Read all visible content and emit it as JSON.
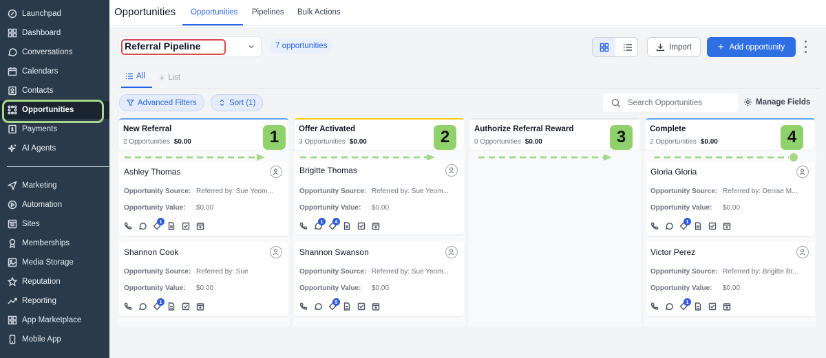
{
  "sidebar": {
    "items": [
      {
        "label": "Launchpad",
        "icon": "rocket-icon"
      },
      {
        "label": "Dashboard",
        "icon": "dashboard-icon"
      },
      {
        "label": "Conversations",
        "icon": "chat-icon"
      },
      {
        "label": "Calendars",
        "icon": "calendar-icon"
      },
      {
        "label": "Contacts",
        "icon": "contacts-icon"
      },
      {
        "label": "Opportunities",
        "icon": "opportunities-icon"
      },
      {
        "label": "Payments",
        "icon": "payments-icon"
      },
      {
        "label": "AI Agents",
        "icon": "sparkle-icon"
      },
      {
        "label": "Marketing",
        "icon": "send-icon"
      },
      {
        "label": "Automation",
        "icon": "automation-icon"
      },
      {
        "label": "Sites",
        "icon": "sites-icon"
      },
      {
        "label": "Memberships",
        "icon": "membership-icon"
      },
      {
        "label": "Media Storage",
        "icon": "image-icon"
      },
      {
        "label": "Reputation",
        "icon": "star-icon"
      },
      {
        "label": "Reporting",
        "icon": "chart-icon"
      },
      {
        "label": "App Marketplace",
        "icon": "apps-icon"
      },
      {
        "label": "Mobile App",
        "icon": "mobile-icon"
      }
    ],
    "active": "Opportunities"
  },
  "header": {
    "title": "Opportunities",
    "tabs": [
      "Opportunities",
      "Pipelines",
      "Bulk Actions"
    ],
    "active_tab": "Opportunities"
  },
  "toolbar": {
    "pipeline": "Referral Pipeline",
    "count": "7 opportunities",
    "import_label": "Import",
    "add_label": "Add opportunity"
  },
  "views": {
    "all": "All",
    "list": "List"
  },
  "filters": {
    "advanced": "Advanced Filters",
    "sort": "Sort (1)",
    "search_placeholder": "Search Opportunities",
    "manage_fields": "Manage Fields"
  },
  "colors": {
    "accent": "#2f6fe4",
    "highlight_green": "#8fd16a",
    "stage_new": "#60a5fa",
    "stage_offer": "#facc15",
    "stage_complete": "#60a5fa"
  },
  "card_labels": {
    "source": "Opportunity Source:",
    "value": "Opportunity Value:"
  },
  "columns": [
    {
      "title": "New Referral",
      "count": "2 Opportunities",
      "amount": "$0.00",
      "badge": "1",
      "cards": [
        {
          "name": "Ashley Thomas",
          "source": "Referred by: Sue Yeom...",
          "value": "$0.00",
          "badge": "1"
        },
        {
          "name": "Shannon Cook",
          "source": "Referred by: Sue",
          "value": "$0.00",
          "badge": "1"
        }
      ]
    },
    {
      "title": "Offer Activated",
      "count": "3 Opportunities",
      "amount": "$0.00",
      "badge": "2",
      "cards": [
        {
          "name": "Brigitte Thomas",
          "source": "Referred by: Sue Yeom...",
          "value": "$0.00",
          "badge": "4",
          "chat_badge": "1"
        },
        {
          "name": "Shannon Swanson",
          "source": "Referred by: Sue Yeom...",
          "value": "$0.00",
          "badge": "5"
        }
      ]
    },
    {
      "title": "Authorize Referral Reward",
      "count": "0 Opportunities",
      "amount": "$0.00",
      "badge": "3",
      "cards": []
    },
    {
      "title": "Complete",
      "count": "2 Opportunities",
      "amount": "$0.00",
      "badge": "4",
      "cards": [
        {
          "name": "Gloria Gloria",
          "source": "Referred by: Denise M...",
          "value": "$0.00",
          "badge": "1"
        },
        {
          "name": "Victor Perez",
          "source": "Referred by: Brigitte Br...",
          "value": "$0.00",
          "badge": "1"
        }
      ]
    }
  ]
}
